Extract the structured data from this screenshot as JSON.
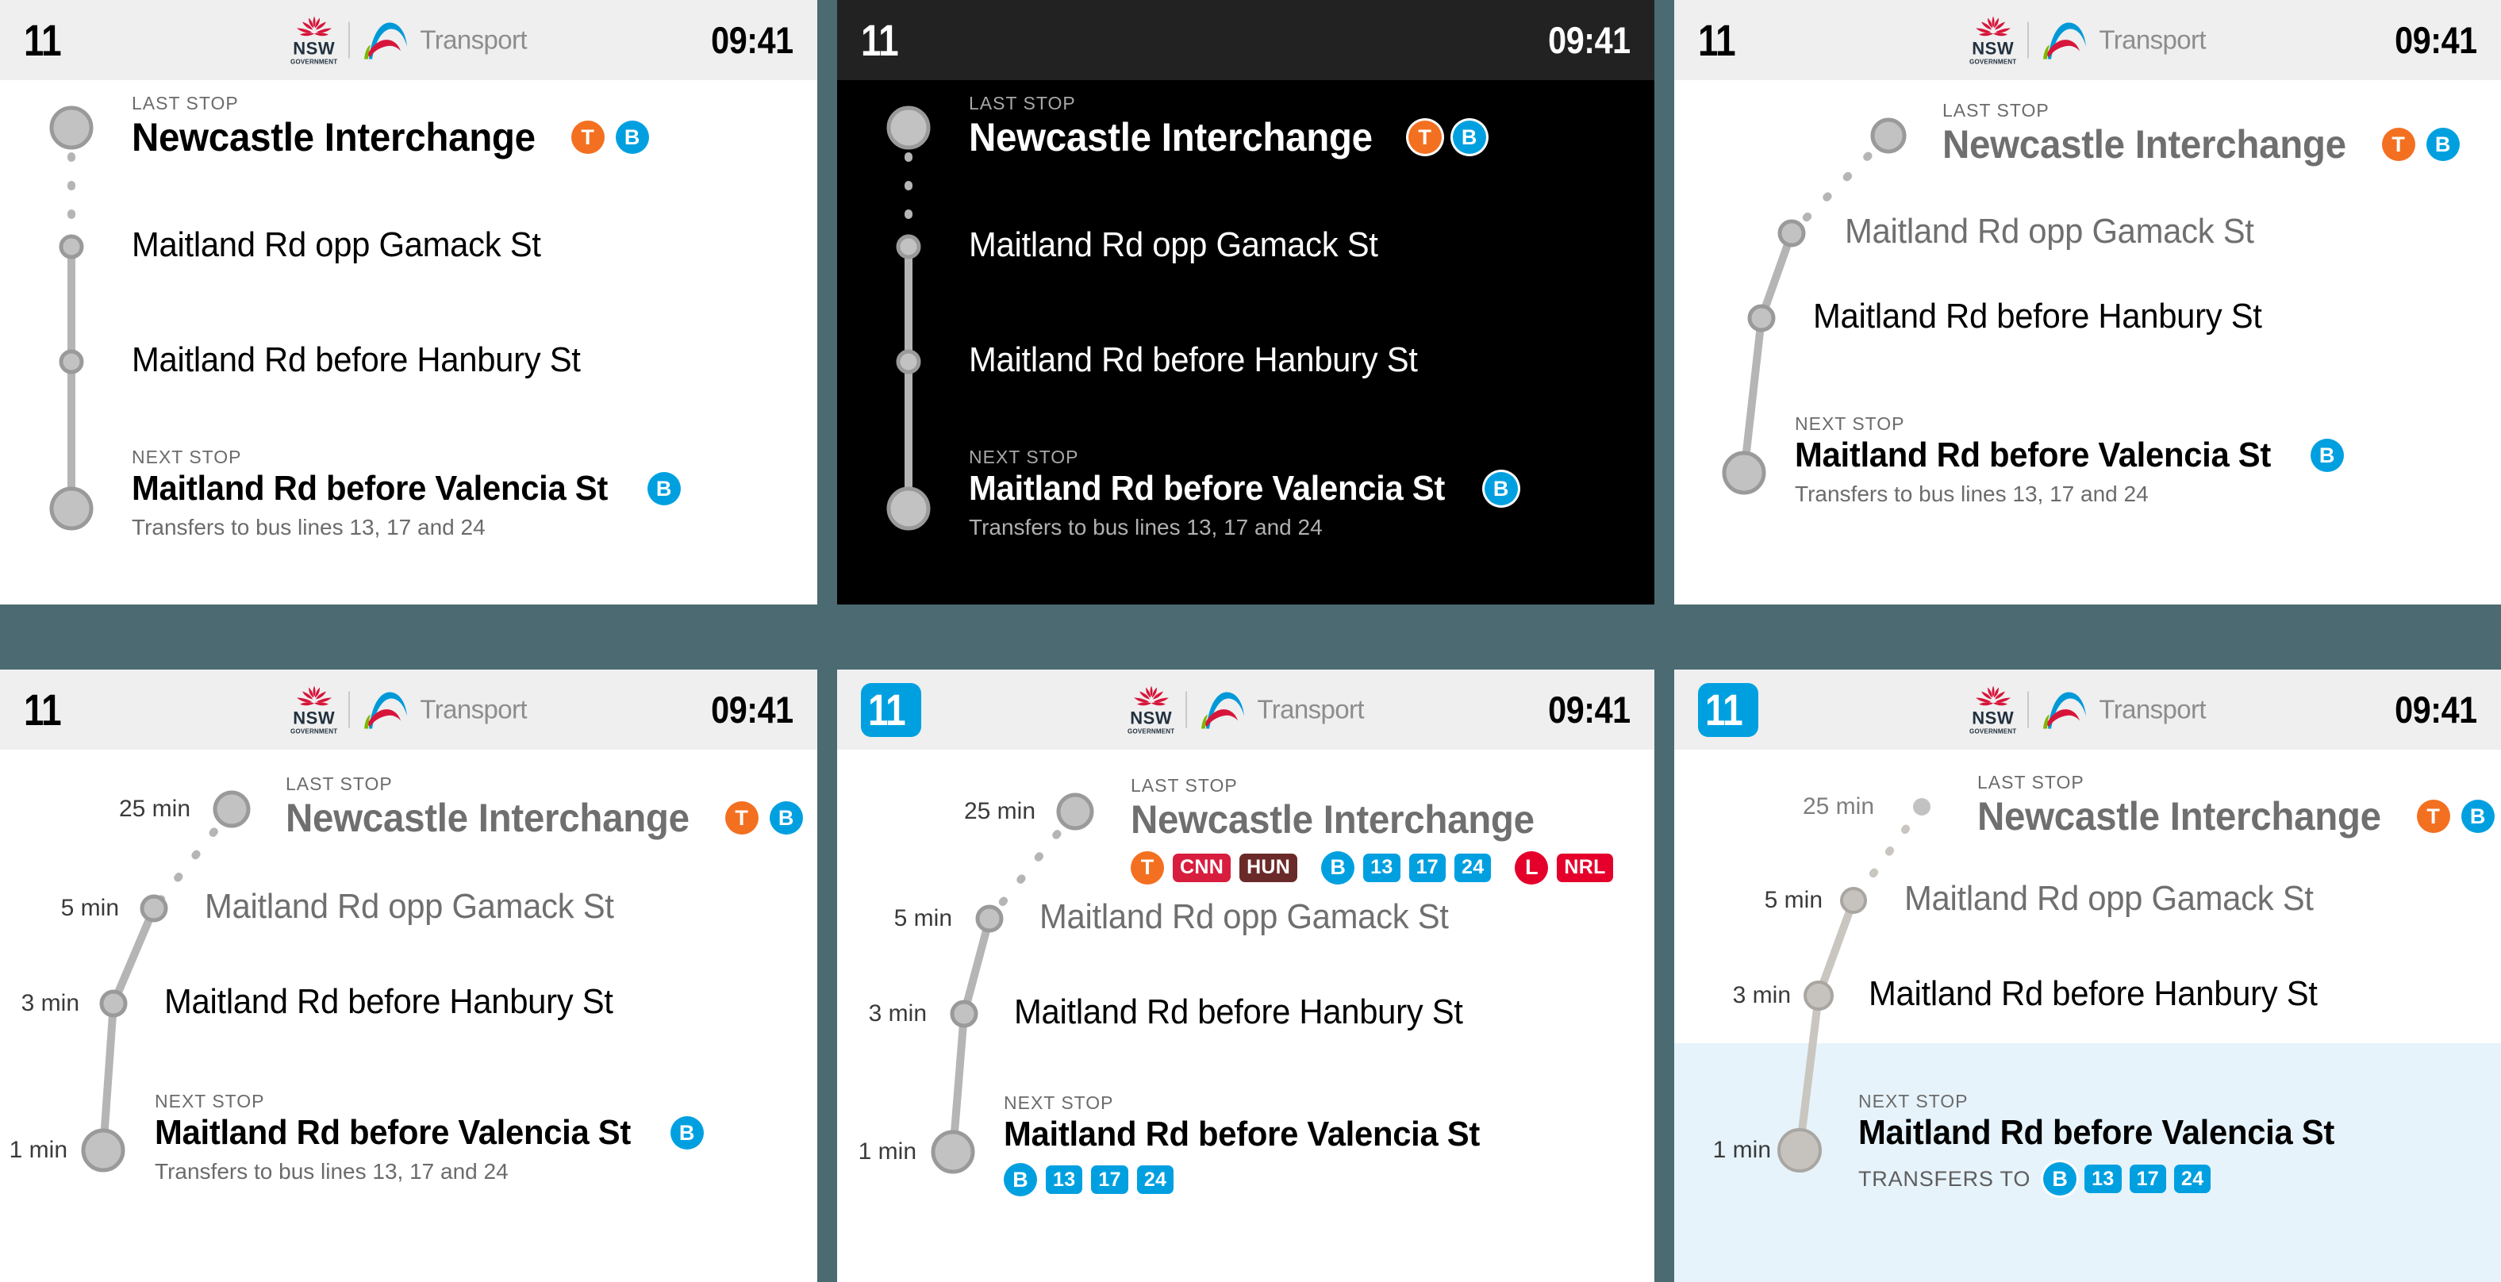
{
  "brand": {
    "nsw_wordmark": "NSW",
    "nsw_sub": "GOVERNMENT",
    "transport_word": "Transport",
    "logo_colors": {
      "waratah_red": "#d7153a",
      "nsw_navy": "#22313f",
      "arch_blue": "#0099d8",
      "arch_red": "#d7153a",
      "arch_green": "#7ab800",
      "wordmark_grey": "#8d8d8d"
    }
  },
  "colors": {
    "page_background": "#4b6a71",
    "panel_light": "#ffffff",
    "panel_dark": "#000000",
    "header_light": "#efefef",
    "header_dark": "#222222",
    "highlight_band": "#e6f3fb",
    "route_line": "#b5b5b5",
    "stop_fill": "#c2c2c2",
    "stop_stroke": "#9a9a9a",
    "mode_train_orange": "#f37021",
    "mode_bus_blue": "#00a0e0",
    "mode_light_rail_red": "#e4002b",
    "chip_bus_blue": "#00a0e0",
    "chip_cnn_red": "#d81e3f",
    "chip_hun_maroon": "#6b2a2a",
    "chip_nrl_red": "#e4002b",
    "kicker_grey": "#6b6b6b",
    "muted_text": "#6f6f6f"
  },
  "header": {
    "route_number": "11",
    "time": "09:41"
  },
  "labels": {
    "last_stop": "LAST STOP",
    "next_stop": "NEXT STOP",
    "transfers_to": "TRANSFERS TO",
    "transfers_sentence": "Transfers to bus lines 13, 17 and 24"
  },
  "stops": {
    "newcastle": "Newcastle Interchange",
    "gamack": "Maitland Rd opp Gamack St",
    "hanbury": "Maitland Rd before Hanbury St",
    "valencia": "Maitland Rd before Valencia St"
  },
  "etas": {
    "newcastle": "25 min",
    "gamack": "5 min",
    "hanbury": "3 min",
    "valencia": "1 min"
  },
  "modes": {
    "train": "T",
    "bus": "B",
    "light_rail": "L"
  },
  "chips": {
    "cnn": "CNN",
    "hun": "HUN",
    "nrl": "NRL",
    "bus_13": "13",
    "bus_17": "17",
    "bus_24": "24"
  },
  "panels": [
    {
      "id": "panel-1",
      "variant": "light-vertical-plain",
      "theme": "light",
      "route_badge": "plain",
      "line_shape": "vertical",
      "eta_column": false,
      "highlight_band": false,
      "transfers_style": "sentence"
    },
    {
      "id": "panel-2",
      "variant": "dark-vertical-plain",
      "theme": "dark",
      "route_badge": "plain",
      "line_shape": "vertical",
      "eta_column": false,
      "highlight_band": false,
      "transfers_style": "sentence"
    },
    {
      "id": "panel-3",
      "variant": "light-angled-plain",
      "theme": "light",
      "route_badge": "plain",
      "line_shape": "angled",
      "eta_column": false,
      "highlight_band": false,
      "transfers_style": "sentence"
    },
    {
      "id": "panel-4",
      "variant": "light-angled-eta",
      "theme": "light",
      "route_badge": "plain",
      "line_shape": "angled",
      "eta_column": true,
      "highlight_band": false,
      "transfers_style": "sentence"
    },
    {
      "id": "panel-5",
      "variant": "light-angled-eta-chips",
      "theme": "light",
      "route_badge": "chip",
      "line_shape": "angled",
      "eta_column": true,
      "highlight_band": false,
      "transfers_style": "chips"
    },
    {
      "id": "panel-6",
      "variant": "light-angled-eta-highlight",
      "theme": "light",
      "route_badge": "chip",
      "line_shape": "angled",
      "eta_column": true,
      "highlight_band": true,
      "transfers_style": "transfers-to-chips"
    }
  ]
}
